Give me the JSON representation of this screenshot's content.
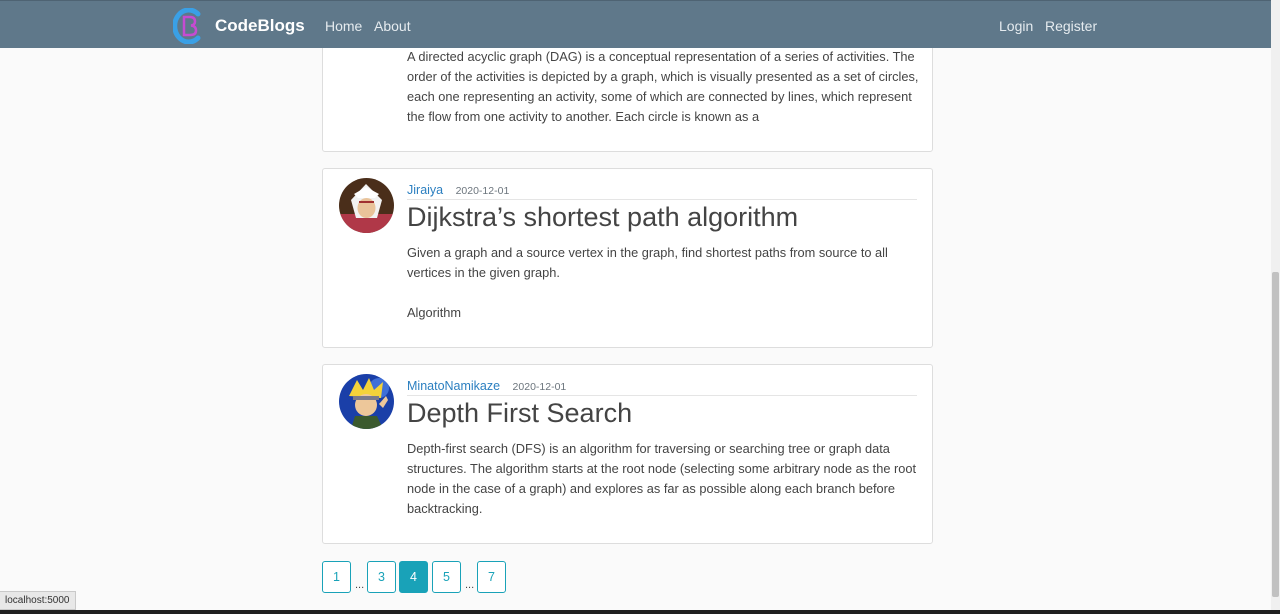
{
  "navbar": {
    "brand": "CodeBlogs",
    "links": {
      "home": "Home",
      "about": "About",
      "login": "Login",
      "register": "Register"
    },
    "background": "#5f788a"
  },
  "articles": [
    {
      "author": "",
      "date": "",
      "title": "",
      "content": "A directed acyclic graph (DAG) is a conceptual representation of a series of activities. The order of the activities is depicted by a graph, which is visually presented as a set of circles, each one representing an activity, some of which are connected by lines, which represent the flow from one activity to another. Each circle is known as a"
    },
    {
      "author": "Jiraiya",
      "date": "2020-12-01",
      "title": "Dijkstra’s shortest path algorithm",
      "content": "Given a graph and a source vertex in the graph, find shortest paths from source to all vertices in the given graph.\n\nAlgorithm"
    },
    {
      "author": "MinatoNamikaze",
      "date": "2020-12-01",
      "title": "Depth First Search",
      "content": "Depth-first search (DFS) is an algorithm for traversing or searching tree or graph data structures. The algorithm starts at the root node (selecting some arbitrary node as the root node in the case of a graph) and explores as far as possible along each branch before backtracking."
    }
  ],
  "pagination": {
    "pages": [
      "1",
      "3",
      "4",
      "5",
      "7"
    ],
    "ellipsis": "...",
    "current": "4",
    "accent": "#19a2b8"
  },
  "status": {
    "url": "localhost:5000"
  }
}
